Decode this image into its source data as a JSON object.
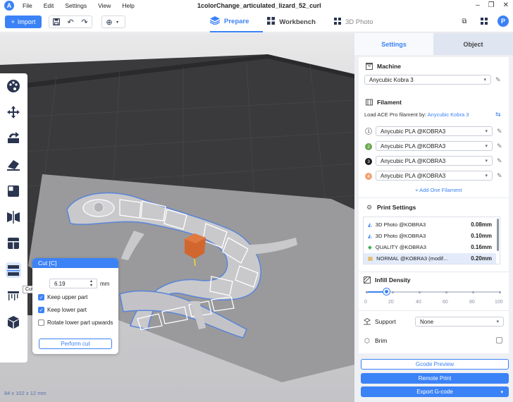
{
  "app": {
    "title": "1colorChange_articulated_lizard_52_curl",
    "logo": "A",
    "menu": [
      "File",
      "Edit",
      "Settings",
      "View",
      "Help"
    ]
  },
  "toolbar": {
    "import_label": "Import",
    "tabs": [
      {
        "label": "Prepare",
        "icon": "layers-icon",
        "active": true
      },
      {
        "label": "Workbench",
        "icon": "grid-icon",
        "active": false
      },
      {
        "label": "3D Photo",
        "icon": "grid-icon",
        "active": false
      }
    ],
    "avatar": "P"
  },
  "viewport": {
    "dimensions": "84 x 102 x 12 mm"
  },
  "tooltip": "Cut [C]",
  "cut_dialog": {
    "title": "Cut [C]",
    "height_value": "6.19",
    "unit": "mm",
    "keep_upper": "Keep upper part",
    "keep_lower": "Keep lower part",
    "rotate_lower": "Rotate lower part upwards",
    "keep_upper_checked": true,
    "keep_lower_checked": true,
    "rotate_lower_checked": false,
    "perform": "Perform cut"
  },
  "panel": {
    "tabs": [
      "Settings",
      "Object"
    ],
    "machine_title": "Machine",
    "machine_value": "Anycubic Kobra 3",
    "filament_title": "Filament",
    "load_ace_label": "Load ACE Pro filament by:",
    "load_ace_link": "Anycubic Kobra 3",
    "filaments": [
      {
        "num": "1",
        "name": "Anycubic PLA @KOBRA3",
        "color": "#ffffff"
      },
      {
        "num": "2",
        "name": "Anycubic PLA @KOBRA3",
        "color": "#6aa84f"
      },
      {
        "num": "3",
        "name": "Anycubic PLA @KOBRA3",
        "color": "#1b1b1b"
      },
      {
        "num": "4",
        "name": "Anycubic PLA @KOBRA3",
        "color": "#f2a271"
      }
    ],
    "add_filament": "+ Add One Filament",
    "print_settings_title": "Print Settings",
    "print_settings": [
      {
        "name": "3D Photo @KOBRA3",
        "value": "0.08mm",
        "selected": false
      },
      {
        "name": "3D Photo @KOBRA3",
        "value": "0.10mm",
        "selected": false
      },
      {
        "name": "QUALITY @KOBRA3",
        "value": "0.16mm",
        "selected": false
      },
      {
        "name": "NORMAL @KOBRA3 (modif...",
        "value": "0.20mm",
        "selected": true
      }
    ],
    "infill_title": "Infill Density",
    "infill_value": 15,
    "infill_ticks": [
      "0",
      "20",
      "40",
      "60",
      "80",
      "100"
    ],
    "support_label": "Support",
    "support_value": "None",
    "brim_label": "Brim",
    "gcode_preview": "Gcode Preview",
    "remote_print": "Remote Print",
    "export_gcode": "Export G-code"
  },
  "colors": {
    "accent": "#3b82f6",
    "cube": "#d2662f"
  }
}
